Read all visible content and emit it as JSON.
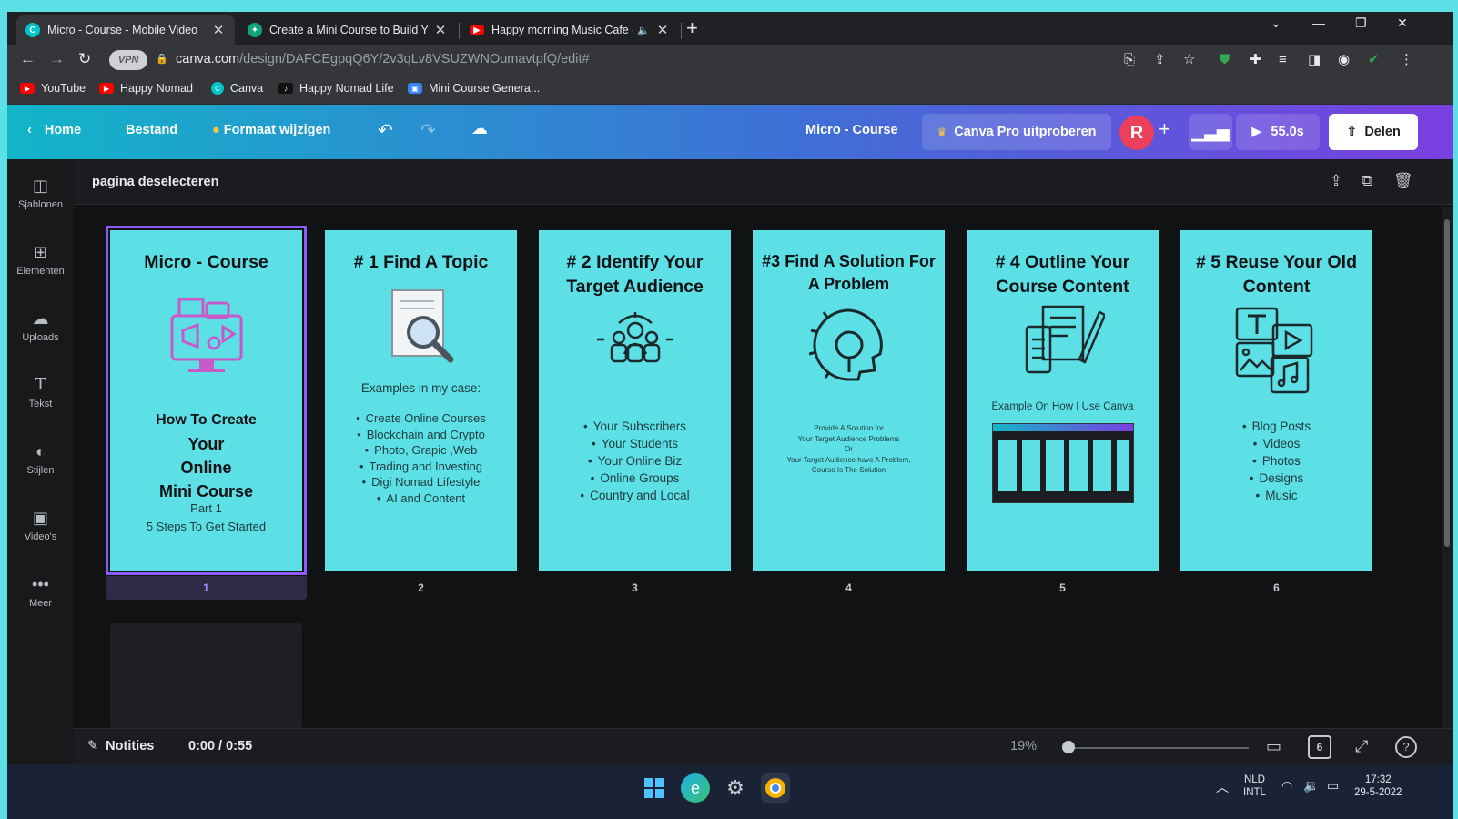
{
  "browser": {
    "tabs": [
      {
        "title": "Micro - Course - Mobile Video",
        "favicon": "canva-icon",
        "favicon_color": "#00c4cc",
        "active": true
      },
      {
        "title": "Create a Mini Course to Build Yo",
        "favicon": "chatgpt-icon",
        "favicon_color": "#10a37f",
        "active": false
      },
      {
        "title": "Happy morning Music Cafe -",
        "favicon": "youtube-icon",
        "favicon_color": "#ff0000",
        "active": false
      }
    ],
    "url_domain": "canva.com",
    "url_path": "/design/DAFCEgpqQ6Y/2v3qLv8VSUZWNOumavtpfQ/edit#",
    "vpn_label": "VPN",
    "bookmarks": [
      {
        "label": "YouTube",
        "icon": "youtube-icon",
        "color": "#ff0000"
      },
      {
        "label": "Happy Nomad",
        "icon": "youtube-icon",
        "color": "#ff0000"
      },
      {
        "label": "Canva",
        "icon": "canva-icon",
        "color": "#00c4cc"
      },
      {
        "label": "Happy Nomad Life",
        "icon": "tiktok-icon",
        "color": "#111111"
      },
      {
        "label": "Mini Course Genera...",
        "icon": "image-icon",
        "color": "#3b82f6"
      }
    ]
  },
  "header": {
    "home": "Home",
    "file": "Bestand",
    "resize": "Formaat wijzigen",
    "title": "Micro - Course",
    "pro": "Canva Pro uitproberen",
    "avatar": "R",
    "play": "55.0s",
    "share": "Delen"
  },
  "sidebar": [
    {
      "label": "Sjablonen",
      "icon": "templates-icon"
    },
    {
      "label": "Elementen",
      "icon": "elements-icon"
    },
    {
      "label": "Uploads",
      "icon": "upload-cloud-icon"
    },
    {
      "label": "Tekst",
      "icon": "text-icon"
    },
    {
      "label": "Stijlen",
      "icon": "palette-icon"
    },
    {
      "label": "Video's",
      "icon": "video-icon"
    },
    {
      "label": "Meer",
      "icon": "more-dots-icon"
    }
  ],
  "workspace": {
    "deselect": "pagina deselecteren",
    "pages": [
      {
        "num": "1",
        "title": "Micro - Course",
        "body": [
          "How To Create",
          "Your",
          "Online",
          "Mini Course"
        ],
        "sub": [
          "Part 1",
          "5 Steps To Get Started"
        ]
      },
      {
        "num": "2",
        "title": "# 1 Find A Topic",
        "intro": "Examples in my case:",
        "items": [
          "Create Online Courses",
          "Blockchain and Crypto",
          "Photo, Grapic ,Web",
          "Trading and Investing",
          "Digi Nomad Lifestyle",
          "AI and Content"
        ]
      },
      {
        "num": "3",
        "title": "# 2 Identify Your Target Audience",
        "items": [
          "Your Subscribers",
          "Your Students",
          "Your Online Biz",
          "Online Groups",
          "Country and Local"
        ]
      },
      {
        "num": "4",
        "title": "#3 Find A Solution For A Problem",
        "small": [
          "Provide A Solution for",
          "Your Target Audience Problems",
          "Or",
          "Your Target Audience have A Problem,",
          "Course Is The Solution"
        ]
      },
      {
        "num": "5",
        "title": "# 4 Outline Your Course Content",
        "caption": "Example On How I Use Canva"
      },
      {
        "num": "6",
        "title": "# 5 Reuse Your Old Content",
        "items": [
          "Blog Posts",
          "Videos",
          "Photos",
          "Designs",
          "Music"
        ]
      }
    ]
  },
  "footer": {
    "notes": "Notities",
    "time": "0:00 / 0:55",
    "zoom": "19%",
    "zoom_level": 0.19,
    "page_count": "6"
  },
  "taskbar": {
    "lang1": "NLD",
    "lang2": "INTL",
    "time": "17:32",
    "date": "29-5-2022"
  }
}
